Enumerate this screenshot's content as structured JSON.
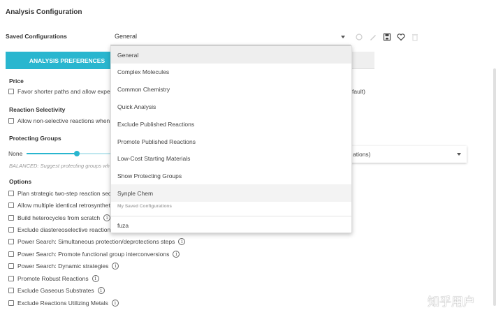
{
  "page": {
    "title": "Analysis Configuration"
  },
  "saved_config": {
    "label": "Saved Configurations",
    "selected": "General",
    "toolbar_icons": [
      "refresh-icon",
      "edit-icon",
      "save-icon",
      "heart-icon",
      "delete-icon"
    ]
  },
  "tabs": [
    {
      "label": "ANALYSIS PREFERENCES",
      "active": true
    },
    {
      "label": "",
      "active": false
    }
  ],
  "sections": {
    "price": {
      "title": "Price",
      "option": "Favor shorter paths and allow expensiv",
      "right_text": "fault)"
    },
    "selectivity": {
      "title": "Reaction Selectivity",
      "option": "Allow non-selective reactions when nec"
    },
    "protecting": {
      "title": "Protecting Groups",
      "slider_min_label": "None",
      "slider_level": 0.59,
      "balanced_text": "BALANCED: Suggest protecting groups wh",
      "right_select_value": "ations)"
    },
    "options": {
      "title": "Options",
      "items": [
        {
          "label": "Plan strategic two-step reaction seque",
          "info": false
        },
        {
          "label": "Allow multiple identical retrosynthetic r",
          "info": false
        },
        {
          "label": "Build heterocycles from scratch",
          "info": true
        },
        {
          "label": "Exclude diastereoselective reactions",
          "info": false
        },
        {
          "label": "Power Search: Simultaneous protection/deprotections steps",
          "info": true
        },
        {
          "label": "Power Search: Promote functional group interconversions",
          "info": true
        },
        {
          "label": "Power Search: Dynamic strategies",
          "info": true
        },
        {
          "label": "Promote Robust Reactions",
          "info": true
        },
        {
          "label": "Exclude Gaseous Substrates",
          "info": true
        },
        {
          "label": "Exclude Reactions Utilizing Metals",
          "info": true
        }
      ]
    }
  },
  "dropdown": {
    "items": [
      {
        "label": "General",
        "state": "selected"
      },
      {
        "label": "Complex Molecules",
        "state": ""
      },
      {
        "label": "Common Chemistry",
        "state": ""
      },
      {
        "label": "Quick Analysis",
        "state": ""
      },
      {
        "label": "Exclude Published Reactions",
        "state": ""
      },
      {
        "label": "Promote Published Reactions",
        "state": ""
      },
      {
        "label": "Low-Cost Starting Materials",
        "state": ""
      },
      {
        "label": "Show Protecting Groups",
        "state": ""
      },
      {
        "label": "Synple Chem",
        "state": "hover"
      }
    ],
    "group_label": "My Saved Configurations",
    "saved_items": [
      {
        "label": "fuza"
      }
    ]
  },
  "watermark": "知乎用户",
  "colors": {
    "accent": "#29b6cf"
  }
}
